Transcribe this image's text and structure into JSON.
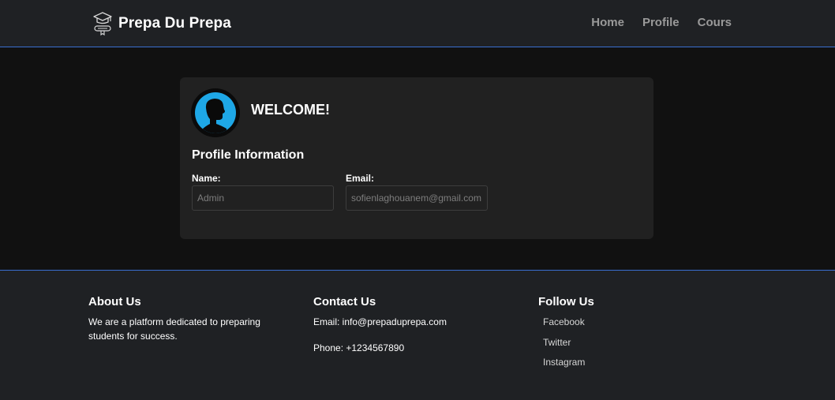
{
  "navbar": {
    "brand_name": "Prepa Du Prepa",
    "brand_icon": "graduation-cap-icon",
    "links": [
      {
        "label": "Home"
      },
      {
        "label": "Profile"
      },
      {
        "label": "Cours"
      }
    ]
  },
  "profile": {
    "avatar_icon": "user-silhouette-icon",
    "welcome": "WELCOME!",
    "section_title": "Profile Information",
    "name_label": "Name:",
    "name_placeholder": "Admin",
    "email_label": "Email:",
    "email_placeholder": "sofienlaghouanem@gmail.com"
  },
  "footer": {
    "about": {
      "title": "About Us",
      "text": "We are a platform dedicated to preparing students for success."
    },
    "contact": {
      "title": "Contact Us",
      "email": "Email: info@prepaduprepa.com",
      "phone": "Phone: +1234567890"
    },
    "follow": {
      "title": "Follow Us",
      "links": [
        {
          "label": "Facebook"
        },
        {
          "label": "Twitter"
        },
        {
          "label": "Instagram"
        }
      ]
    }
  },
  "colors": {
    "background": "#111111",
    "navbar_bg": "#1f2124",
    "card_bg": "#212121",
    "accent_border": "#3a6fd0",
    "avatar_blue": "#1ea7e6"
  }
}
